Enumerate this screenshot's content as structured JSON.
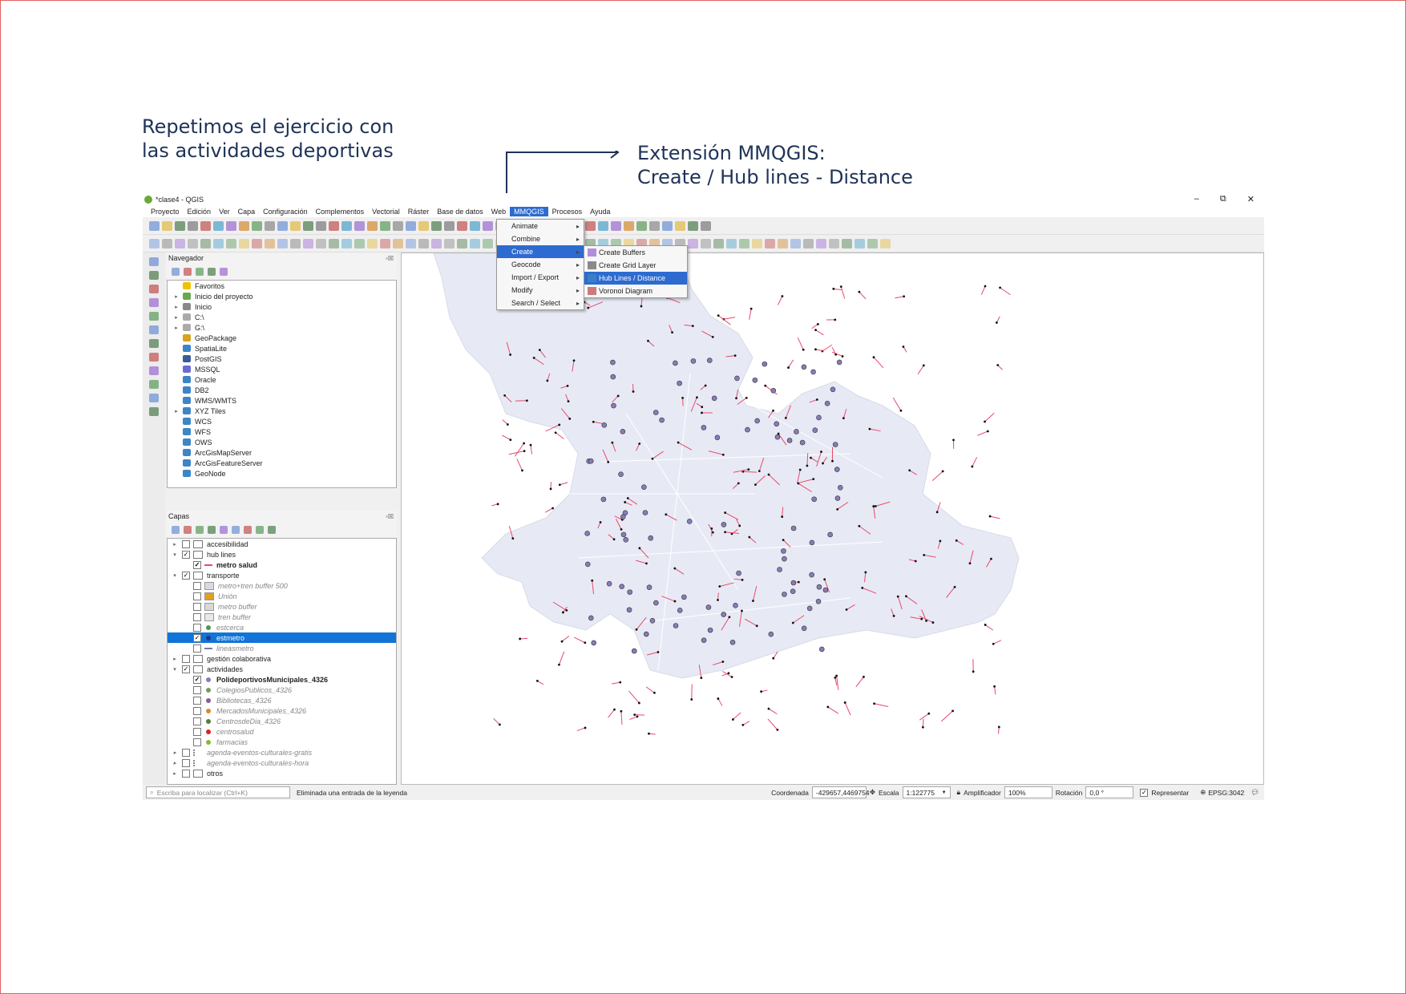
{
  "slide": {
    "heading_line1": "Repetimos el ejercicio con",
    "heading_line2": "las actividades deportivas",
    "callout_line1": "Extensión MMQGIS:",
    "callout_line2": "Create / Hub lines - Distance",
    "text_color": "#1f3358",
    "border_color": "#e06060"
  },
  "window": {
    "title": "*clase4 - QGIS",
    "minimize_glyph": "–",
    "maximize_glyph": "⧉",
    "close_glyph": "✕"
  },
  "menubar": {
    "items": [
      "Proyecto",
      "Edición",
      "Ver",
      "Capa",
      "Configuración",
      "Complementos",
      "Vectorial",
      "Ráster",
      "Base de datos",
      "Web",
      "MMQGIS",
      "Procesos",
      "Ayuda"
    ],
    "active": "MMQGIS"
  },
  "mmqgis_menu": {
    "items": [
      "Animate",
      "Combine",
      "Create",
      "Geocode",
      "Import / Export",
      "Modify",
      "Search / Select"
    ],
    "highlighted": "Create"
  },
  "create_submenu": {
    "items": [
      "Create Buffers",
      "Create Grid Layer",
      "Hub Lines / Distance",
      "Voronoi Diagram"
    ],
    "highlighted": "Hub Lines / Distance"
  },
  "navigator": {
    "title": "Navegador",
    "items": [
      {
        "label": "Favoritos",
        "expand": "",
        "icon": "star-icon",
        "color": "#f2c200"
      },
      {
        "label": "Inicio del proyecto",
        "expand": "▸",
        "icon": "project-folder-icon",
        "color": "#6aa84f"
      },
      {
        "label": "Inicio",
        "expand": "▸",
        "icon": "home-folder-icon",
        "color": "#888888"
      },
      {
        "label": "C:\\",
        "expand": "▸",
        "icon": "drive-icon",
        "color": "#aaaaaa"
      },
      {
        "label": "G:\\",
        "expand": "▸",
        "icon": "drive-icon",
        "color": "#aaaaaa"
      },
      {
        "label": "GeoPackage",
        "expand": "",
        "icon": "geopackage-icon",
        "color": "#d9a21b"
      },
      {
        "label": "SpatiaLite",
        "expand": "",
        "icon": "spatialite-icon",
        "color": "#3d85c6"
      },
      {
        "label": "PostGIS",
        "expand": "",
        "icon": "postgis-icon",
        "color": "#3d5a98"
      },
      {
        "label": "MSSQL",
        "expand": "",
        "icon": "mssql-icon",
        "color": "#6b6bd6"
      },
      {
        "label": "Oracle",
        "expand": "",
        "icon": "oracle-icon",
        "color": "#3d85c6"
      },
      {
        "label": "DB2",
        "expand": "",
        "icon": "db2-icon",
        "color": "#3d85c6"
      },
      {
        "label": "WMS/WMTS",
        "expand": "",
        "icon": "globe-icon",
        "color": "#3d85c6"
      },
      {
        "label": "XYZ Tiles",
        "expand": "▸",
        "icon": "globe-icon",
        "color": "#3d85c6"
      },
      {
        "label": "WCS",
        "expand": "",
        "icon": "globe-icon",
        "color": "#3d85c6"
      },
      {
        "label": "WFS",
        "expand": "",
        "icon": "globe-icon",
        "color": "#3d85c6"
      },
      {
        "label": "OWS",
        "expand": "",
        "icon": "globe-icon",
        "color": "#3d85c6"
      },
      {
        "label": "ArcGisMapServer",
        "expand": "",
        "icon": "arcgis-icon",
        "color": "#3d85c6"
      },
      {
        "label": "ArcGisFeatureServer",
        "expand": "",
        "icon": "arcgis-icon",
        "color": "#3d85c6"
      },
      {
        "label": "GeoNode",
        "expand": "",
        "icon": "geonode-icon",
        "color": "#3d85c6"
      }
    ]
  },
  "layers": {
    "title": "Capas",
    "items": [
      {
        "label": "accesibilidad",
        "indent": 0,
        "expand": "▸",
        "checked": false,
        "symbol": "group-icon",
        "style": ""
      },
      {
        "label": "hub lines",
        "indent": 0,
        "expand": "▾",
        "checked": true,
        "symbol": "group-icon",
        "style": ""
      },
      {
        "label": "metro salud",
        "indent": 1,
        "expand": "",
        "checked": true,
        "symbol": "line-symbol",
        "color": "#e8496b",
        "style": "bold"
      },
      {
        "label": "transporte",
        "indent": 0,
        "expand": "▾",
        "checked": true,
        "symbol": "group-icon",
        "style": ""
      },
      {
        "label": "metro+tren buffer 500",
        "indent": 1,
        "expand": "",
        "checked": false,
        "symbol": "fill-symbol",
        "color": "#d8d8e8",
        "style": "dim"
      },
      {
        "label": "Unión",
        "indent": 1,
        "expand": "",
        "checked": false,
        "symbol": "fill-symbol",
        "color": "#e0a020",
        "style": "dim"
      },
      {
        "label": "metro buffer",
        "indent": 1,
        "expand": "",
        "checked": false,
        "symbol": "fill-symbol",
        "color": "#d8d8d8",
        "style": "dim"
      },
      {
        "label": "tren buffer",
        "indent": 1,
        "expand": "",
        "checked": false,
        "symbol": "fill-symbol",
        "color": "#e8e8e8",
        "style": "dim"
      },
      {
        "label": "estcerca",
        "indent": 1,
        "expand": "",
        "checked": false,
        "symbol": "point-symbol",
        "color": "#4a9a4a",
        "style": "dim"
      },
      {
        "label": "estmetro",
        "indent": 1,
        "expand": "",
        "checked": true,
        "symbol": "point-symbol",
        "color": "#1a3a8a",
        "style": "sel"
      },
      {
        "label": "lineasmetro",
        "indent": 1,
        "expand": "",
        "checked": false,
        "symbol": "line-symbol",
        "color": "#7a7aaa",
        "style": "dim"
      },
      {
        "label": "gestión colaborativa",
        "indent": 0,
        "expand": "▸",
        "checked": false,
        "symbol": "group-icon",
        "style": ""
      },
      {
        "label": "actividades",
        "indent": 0,
        "expand": "▾",
        "checked": true,
        "symbol": "group-icon",
        "style": ""
      },
      {
        "label": "PolideportivosMunicipales_4326",
        "indent": 1,
        "expand": "",
        "checked": true,
        "symbol": "point-symbol",
        "color": "#8a7ab8",
        "style": "bold"
      },
      {
        "label": "ColegiosPublicos_4326",
        "indent": 1,
        "expand": "",
        "checked": false,
        "symbol": "point-symbol",
        "color": "#7a9a5a",
        "style": "dim"
      },
      {
        "label": "Bibliotecas_4326",
        "indent": 1,
        "expand": "",
        "checked": false,
        "symbol": "point-symbol",
        "color": "#8a5a9a",
        "style": "dim"
      },
      {
        "label": "MercadosMunicipales_4326",
        "indent": 1,
        "expand": "",
        "checked": false,
        "symbol": "point-symbol",
        "color": "#d88a2a",
        "style": "dim"
      },
      {
        "label": "CentrosdeDia_4326",
        "indent": 1,
        "expand": "",
        "checked": false,
        "symbol": "point-symbol",
        "color": "#5a7a3a",
        "style": "dim"
      },
      {
        "label": "centrosalud",
        "indent": 1,
        "expand": "",
        "checked": false,
        "symbol": "point-symbol",
        "color": "#e02020",
        "style": "dim"
      },
      {
        "label": "farmacias",
        "indent": 1,
        "expand": "",
        "checked": false,
        "symbol": "point-symbol",
        "color": "#8ab830",
        "style": "dim"
      },
      {
        "label": "agenda-eventos-culturales-gratis",
        "indent": 0,
        "expand": "▸",
        "checked": false,
        "symbol": "dots-icon",
        "style": "dim"
      },
      {
        "label": "agenda-eventos-culturales-hora",
        "indent": 0,
        "expand": "▸",
        "checked": false,
        "symbol": "dots-icon",
        "style": "dim"
      },
      {
        "label": "otros",
        "indent": 0,
        "expand": "▸",
        "checked": false,
        "symbol": "group-icon",
        "style": ""
      }
    ]
  },
  "statusbar": {
    "search_placeholder": "Escriba para localizar (Ctrl+K)",
    "message": "Eliminada una entrada de la leyenda",
    "coord_label": "Coordenada",
    "coord_value": "-429657,4469754",
    "scale_label": "Escala",
    "scale_value": "1:122775",
    "magnifier_label": "Amplificador",
    "magnifier_value": "100%",
    "rotation_label": "Rotación",
    "rotation_value": "0,0 °",
    "render_label": "Representar",
    "crs": "EPSG:3042"
  },
  "colors": {
    "accent": "#2d6bd0",
    "selection": "#1074d8",
    "map_fill": "#e7eaf4",
    "hub_line": "#e8496b",
    "sport_point": "#8a7ab8",
    "station_point": "#111111"
  }
}
